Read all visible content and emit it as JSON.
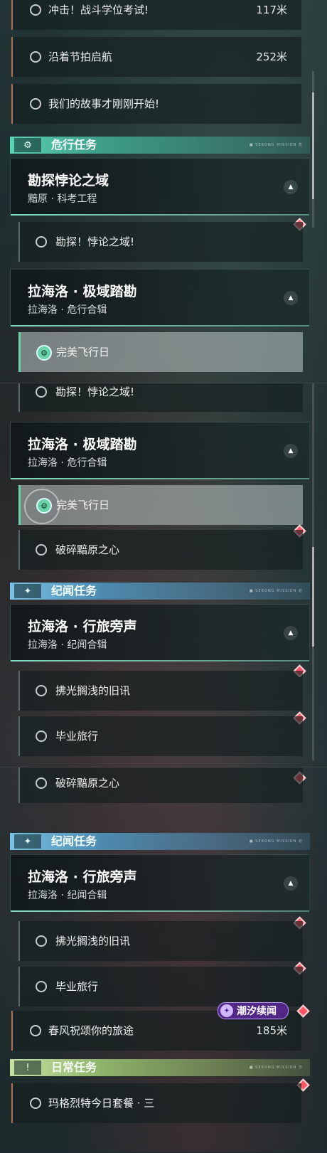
{
  "panel1": {
    "tasks_top": [
      {
        "name": "冲击！战斗学位考试!",
        "distance": "117米"
      },
      {
        "name": "沿着节拍启航",
        "distance": "252米"
      },
      {
        "name": "我们的故事才刚刚开始!",
        "distance": ""
      }
    ],
    "danger_header": {
      "title": "危行任务",
      "tiny": "■ SERONG MISSION 危"
    },
    "card1": {
      "title": "勘探悖论之域",
      "subtitle": "黯原 · 科考工程"
    },
    "sub1": {
      "name": "勘探！悖论之域!"
    },
    "card2": {
      "title": "拉海洛 · 极域踏勘",
      "subtitle": "拉海洛 · 危行合辑"
    },
    "active": {
      "name": "完美飞行日"
    }
  },
  "panel2": {
    "sub1": {
      "name": "勘探！悖论之域!"
    },
    "card": {
      "title": "拉海洛 · 极域踏勘",
      "subtitle": "拉海洛 · 危行合辑"
    },
    "active": {
      "name": "完美飞行日"
    },
    "sub2": {
      "name": "破碎黯原之心"
    },
    "story_header": {
      "title": "纪闻任务",
      "tiny": "■ SERONG MISSION 纪"
    },
    "story_card": {
      "title": "拉海洛 · 行旅旁声",
      "subtitle": "拉海洛 · 纪闻合辑"
    },
    "sub3": {
      "name": "拂光搁浅的旧讯"
    },
    "sub4": {
      "name": "毕业旅行"
    }
  },
  "panel3": {
    "sub1": {
      "name": "破碎黯原之心"
    },
    "story_header": {
      "title": "纪闻任务",
      "tiny": "■ SERONG MISSION 纪"
    },
    "story_card": {
      "title": "拉海洛 · 行旅旁声",
      "subtitle": "拉海洛 · 纪闻合辑"
    },
    "sub2": {
      "name": "拂光搁浅的旧讯"
    },
    "sub3": {
      "name": "毕业旅行"
    },
    "task": {
      "name": "春风祝颂你的旅途",
      "distance": "185米"
    },
    "event_badge": "潮汐续闻",
    "daily_header": {
      "title": "日常任务",
      "tiny": "■ SERONG MISSION 日"
    },
    "daily_task": {
      "name": "玛格烈特今日套餐 · 三"
    }
  },
  "icons": {
    "danger": "gear-icon",
    "story": "sparkle-icon",
    "daily": "exclamation-icon",
    "toggle": "chevron-up-icon",
    "marker": "diamond-marker-icon"
  },
  "colors": {
    "danger": "#5ad3b2",
    "story": "#79c3e6",
    "daily": "#c6e2a2",
    "marker": "#ff5566",
    "event": "#5a2896"
  }
}
